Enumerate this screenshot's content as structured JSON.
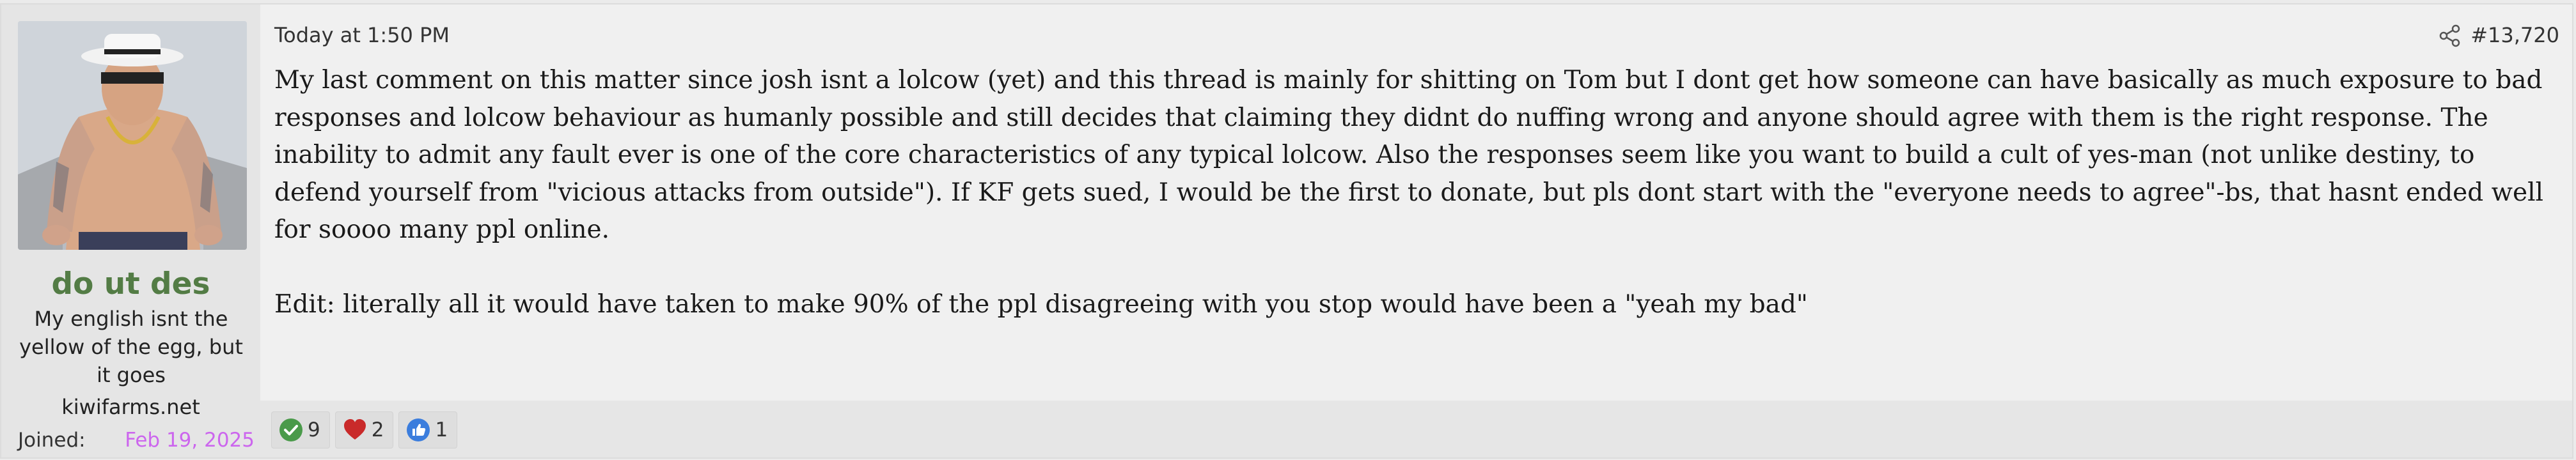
{
  "user": {
    "name": "do ut des",
    "title": "My english isnt the yellow of the egg, but it goes",
    "site": "kiwifarms.net",
    "joined_label": "Joined:",
    "joined_date": "Feb 19, 2025",
    "name_color": "#537c45",
    "joined_date_color": "#cc66ee"
  },
  "post": {
    "time": "Today at 1:50 PM",
    "share_icon": "share-icon",
    "number": "#13,720",
    "paragraph_1": "My last comment on this matter since josh isnt a lolcow (yet) and this thread is mainly for shitting on Tom but I dont get how someone can have basically as much exposure to bad responses and lolcow behaviour as humanly possible and still decides that claiming they didnt do nuffing wrong and anyone should agree with them is the right response. The inability to admit any fault ever is one of the core characteristics of any typical lolcow. Also the responses seem like you want to build a cult of yes-man (not unlike destiny, to defend yourself from \"vicious attacks from outside\"). If KF gets sued, I would be the first to donate, but pls dont start with the \"everyone needs to agree\"-bs, that hasnt ended well for soooo many ppl online.",
    "paragraph_2": "Edit: literally all it would have taken to make 90% of the ppl disagreeing with you stop would have been a \"yeah my bad\""
  },
  "reactions": [
    {
      "icon": "check-icon",
      "count": "9",
      "color": "#4a9a4a"
    },
    {
      "icon": "heart-icon",
      "count": "2",
      "color": "#c92a2a"
    },
    {
      "icon": "thumbs-up-icon",
      "count": "1",
      "color": "#3b7ddd"
    }
  ]
}
